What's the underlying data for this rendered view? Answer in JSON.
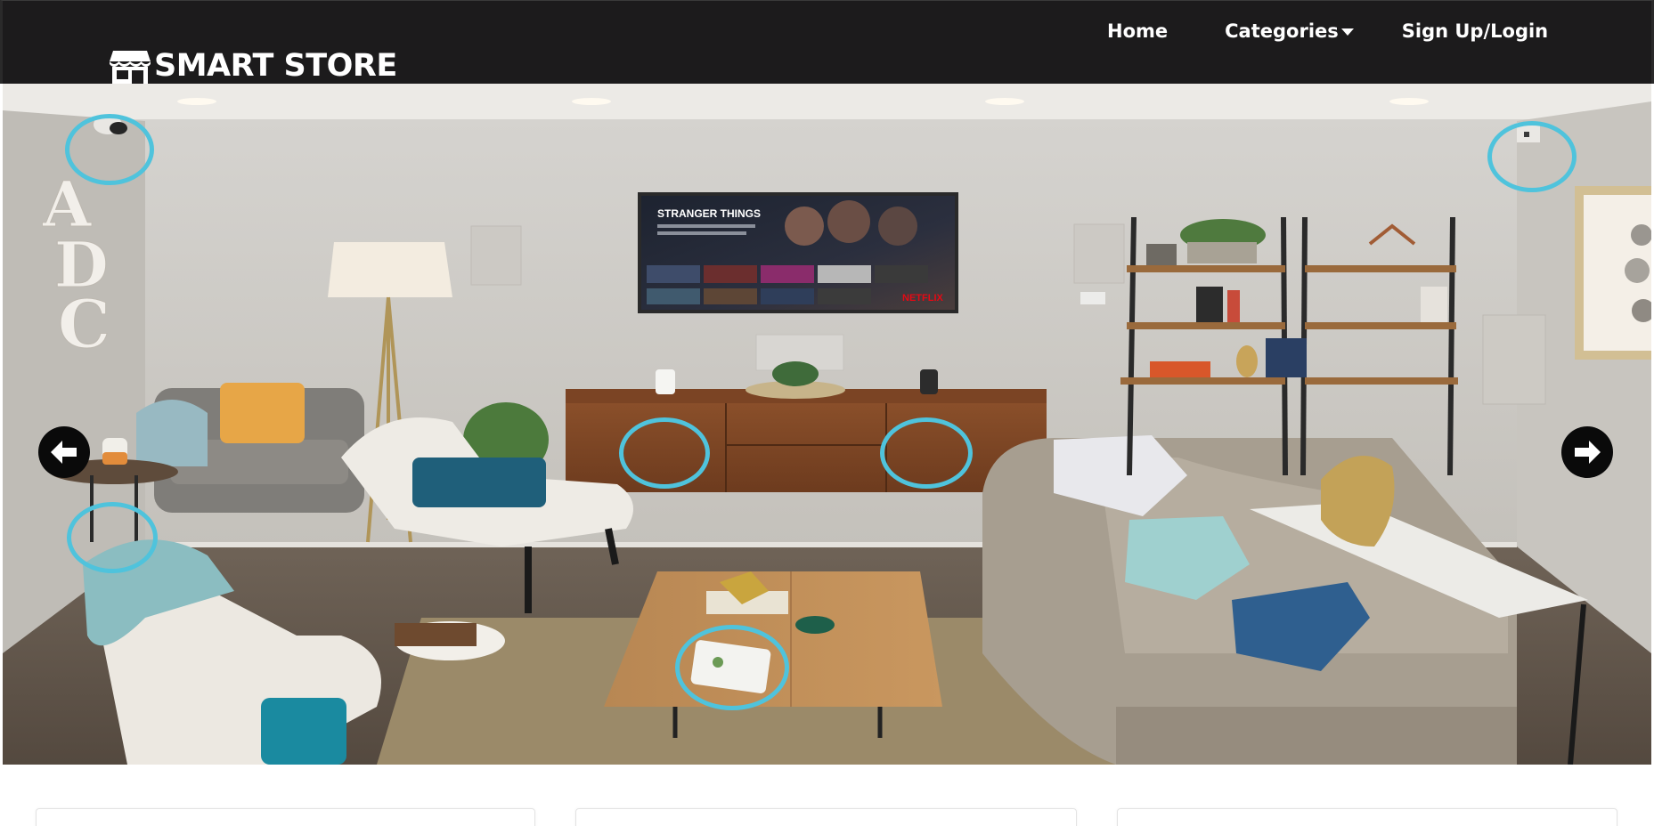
{
  "brand": {
    "name": "SMART STORE",
    "icon": "store-icon"
  },
  "nav": {
    "home": "Home",
    "categories": "Categories",
    "signup": "Sign Up/Login"
  },
  "hero": {
    "tv_title": "STRANGER THINGS",
    "tv_brand": "NETFLIX",
    "wall_letters": [
      "A",
      "D",
      "C"
    ],
    "hotspot_color": "#4fc3dc",
    "prev_icon": "arrow-left-icon",
    "next_icon": "arrow-right-icon"
  },
  "colors": {
    "navbar": "#1c1b1c",
    "accent": "#4fc3dc"
  }
}
